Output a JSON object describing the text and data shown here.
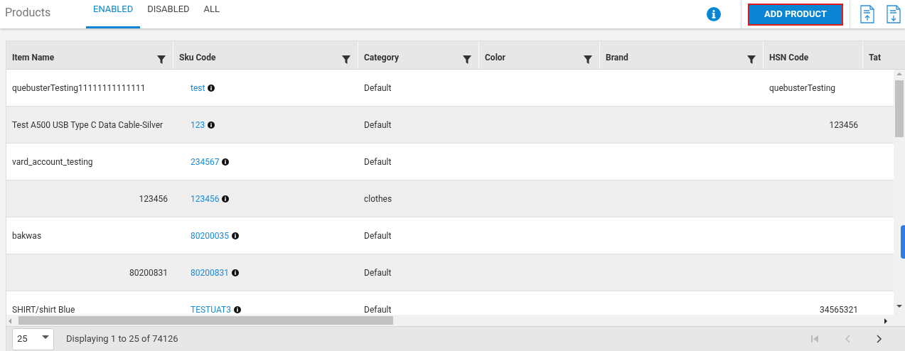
{
  "page_title": "Products",
  "tabs": [
    {
      "label": "ENABLED",
      "selected": true
    },
    {
      "label": "DISABLED",
      "selected": false
    },
    {
      "label": "ALL",
      "selected": false
    }
  ],
  "add_button": "ADD PRODUCT",
  "table": {
    "columns": [
      {
        "label": "Item Name",
        "filter": true
      },
      {
        "label": "Sku Code",
        "filter": true
      },
      {
        "label": "Category",
        "filter": true
      },
      {
        "label": "Color",
        "filter": true
      },
      {
        "label": "Brand",
        "filter": true
      },
      {
        "label": "HSN Code",
        "filter": false
      },
      {
        "label": "Tat",
        "filter": false
      }
    ],
    "rows": [
      {
        "item_name": "quebusterTesting11111111111111",
        "sku": "test",
        "category": "Default",
        "hsn": "quebusterTesting"
      },
      {
        "item_name": "Test A500 USB Type C Data Cable-Silver",
        "sku": "123",
        "category": "Default",
        "hsn": "123456"
      },
      {
        "item_name": "vard_account_testing",
        "sku": "234567",
        "category": "Default"
      },
      {
        "item_name": "123456",
        "sku": "123456",
        "category": "clothes"
      },
      {
        "item_name": "bakwas",
        "sku": "80200035",
        "category": "Default"
      },
      {
        "item_name": "80200831",
        "sku": "80200831",
        "category": "Default"
      },
      {
        "item_name": "SHIRT/shirt Blue",
        "sku": "TESTUAT3",
        "category": "Default",
        "hsn": "34565321"
      }
    ]
  },
  "pagination": {
    "page_size": "25",
    "summary": "Displaying 1 to 25 of 74126"
  }
}
